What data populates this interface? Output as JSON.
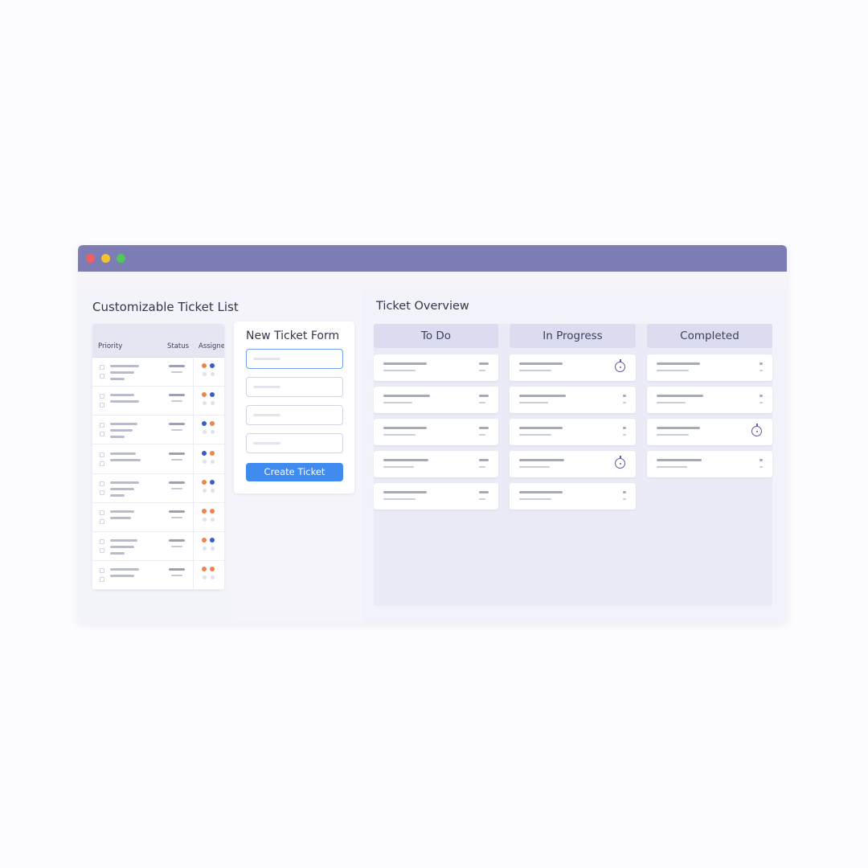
{
  "window": {
    "controls": [
      "close",
      "minimize",
      "maximize"
    ]
  },
  "ticket_list": {
    "title": "Customizable Ticket List",
    "columns": [
      "Priority",
      "Status",
      "Assignee"
    ],
    "rows": [
      {
        "assignee_dots": [
          "orange",
          "blue"
        ]
      },
      {
        "assignee_dots": [
          "orange",
          "blue"
        ]
      },
      {
        "assignee_dots": [
          "blue",
          "orange"
        ]
      },
      {
        "assignee_dots": [
          "blue",
          "orange"
        ]
      },
      {
        "assignee_dots": [
          "orange",
          "blue"
        ]
      },
      {
        "assignee_dots": [
          "orange",
          "orange"
        ]
      },
      {
        "assignee_dots": [
          "orange",
          "blue"
        ]
      },
      {
        "assignee_dots": [
          "orange",
          "orange"
        ]
      }
    ],
    "dot_colors": {
      "orange": "#f0824e",
      "blue": "#3a5bc9"
    }
  },
  "form": {
    "title": "New Ticket Form",
    "field_count": 4,
    "submit_label": "Create Ticket"
  },
  "overview": {
    "title": "Ticket Overview",
    "columns": [
      {
        "name": "To Do",
        "cards": [
          {
            "timer": false
          },
          {
            "timer": false
          },
          {
            "timer": false
          },
          {
            "timer": false
          },
          {
            "timer": false
          }
        ]
      },
      {
        "name": "In Progress",
        "cards": [
          {
            "timer": true
          },
          {
            "timer": false
          },
          {
            "timer": false
          },
          {
            "timer": true
          },
          {
            "timer": false
          }
        ]
      },
      {
        "name": "Completed",
        "cards": [
          {
            "timer": false
          },
          {
            "timer": false
          },
          {
            "timer": true
          },
          {
            "timer": false
          }
        ]
      }
    ]
  },
  "colors": {
    "titlebar": "#7b7db4",
    "accent": "#3f8bef",
    "timer_icon": "#6a52a8"
  }
}
